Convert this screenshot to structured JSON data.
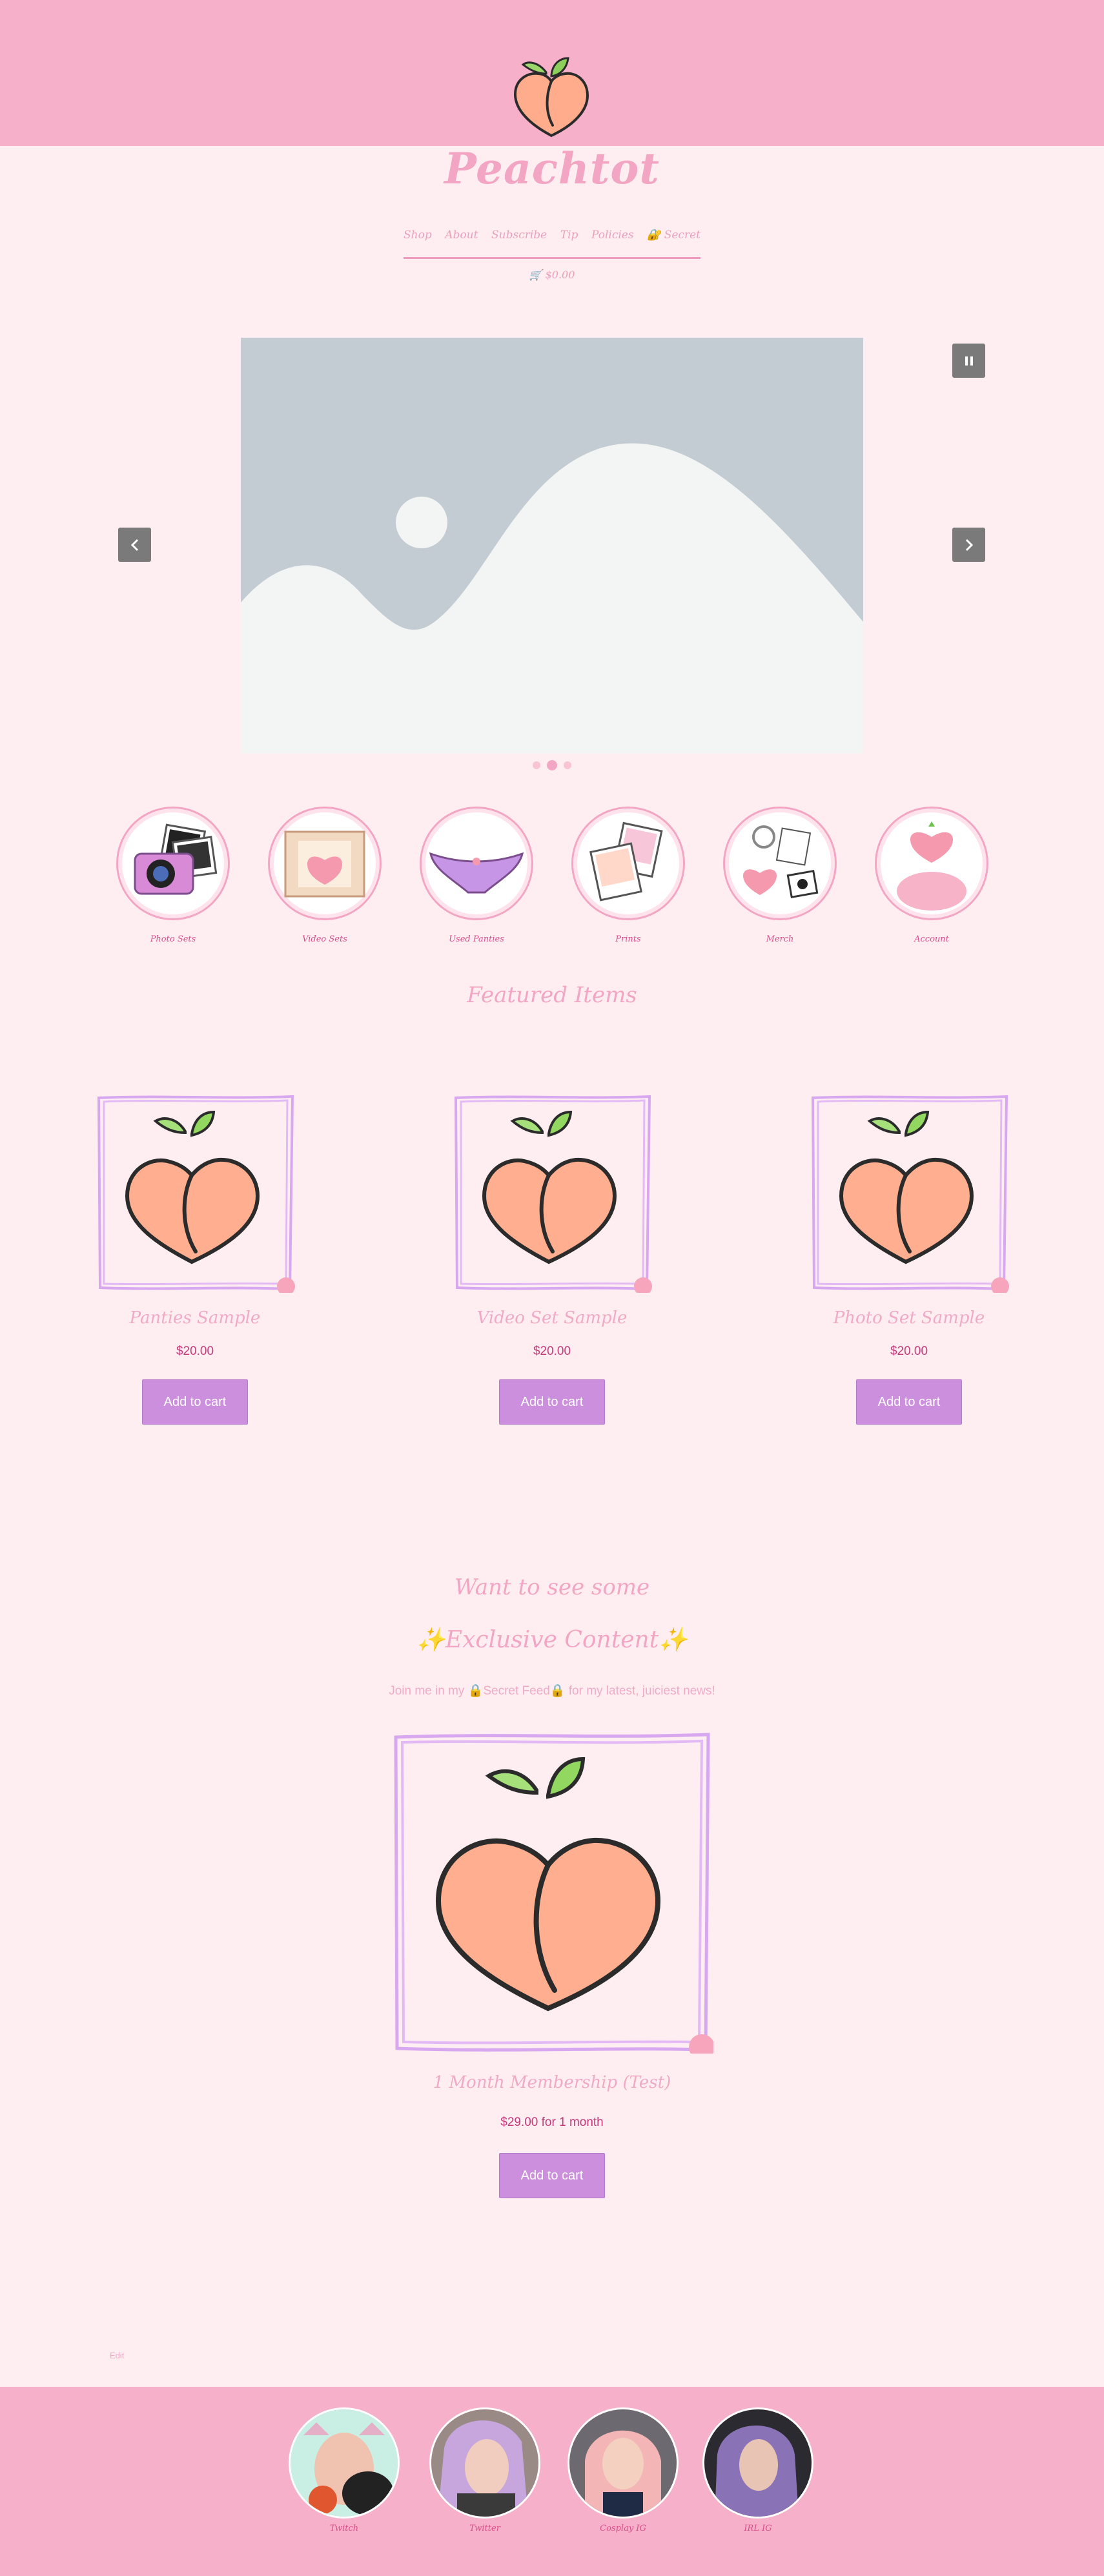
{
  "header": {
    "brand": "Peachtot",
    "logo_icon": "peach-logo-icon"
  },
  "nav": {
    "items": [
      "Shop",
      "About",
      "Subscribe",
      "Tip",
      "Policies",
      "🔐 Secret"
    ]
  },
  "cart": {
    "total": "$0.00",
    "icon": "cart-icon"
  },
  "carousel": {
    "pause_icon": "pause-icon",
    "prev_icon": "chevron-left-icon",
    "next_icon": "chevron-right-icon",
    "slide_count": 3,
    "active_slide": 1
  },
  "categories": [
    {
      "label": "Photo Sets",
      "icon": "camera-photos-icon"
    },
    {
      "label": "Video Sets",
      "icon": "film-strip-icon"
    },
    {
      "label": "Used Panties",
      "icon": "panties-icon"
    },
    {
      "label": "Prints",
      "icon": "polaroid-prints-icon"
    },
    {
      "label": "Merch",
      "icon": "merch-collage-icon"
    },
    {
      "label": "Account",
      "icon": "heart-bust-icon"
    }
  ],
  "featured": {
    "heading": "Featured Items",
    "products": [
      {
        "title": "Panties Sample",
        "price": "$20.00",
        "button": "Add to cart"
      },
      {
        "title": "Video Set Sample",
        "price": "$20.00",
        "button": "Add to cart"
      },
      {
        "title": "Photo Set Sample",
        "price": "$20.00",
        "button": "Add to cart"
      }
    ]
  },
  "exclusive": {
    "line1": "Want to see some",
    "line2": "✨Exclusive Content✨",
    "subtitle": "Join me in my 🔒Secret Feed🔒 for my latest, juiciest news!",
    "product": {
      "title": "1 Month Membership (Test)",
      "price": "$29.00 for 1 month",
      "button": "Add to cart"
    }
  },
  "small_text": "Edit",
  "socials": [
    {
      "label": "Twitch"
    },
    {
      "label": "Twitter"
    },
    {
      "label": "Cosplay IG"
    },
    {
      "label": "IRL IG"
    }
  ],
  "colors": {
    "pink_bar": "#f6b0c9",
    "background": "#ffeef1",
    "accent": "#f3a6c3",
    "button": "#cc8fde",
    "price": "#c43a79"
  }
}
